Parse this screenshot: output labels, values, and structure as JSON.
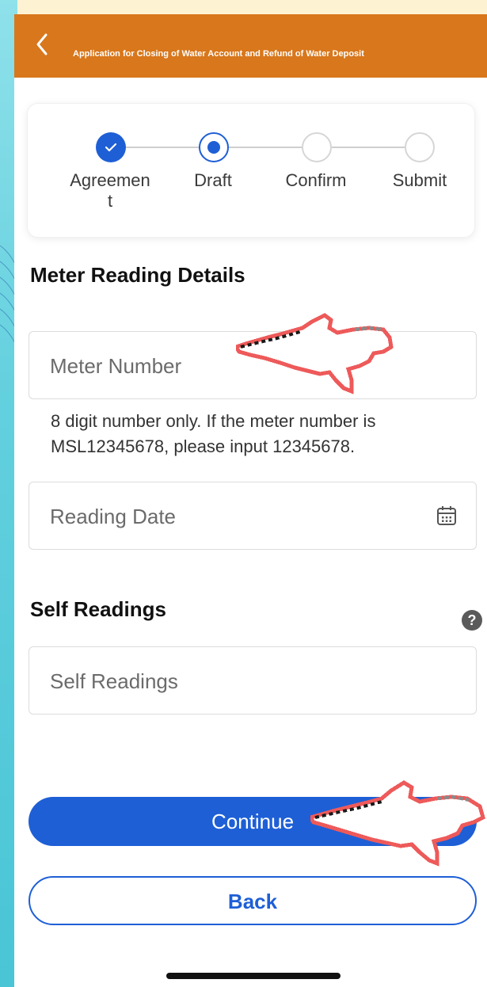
{
  "header": {
    "title": "Application for Closing of Water Account and Refund of Water Deposit",
    "color": "#d8771c"
  },
  "stepper": {
    "steps": [
      {
        "label": "Agreemen\nt",
        "state": "done"
      },
      {
        "label": "Draft",
        "state": "active"
      },
      {
        "label": "Confirm",
        "state": "idle"
      },
      {
        "label": "Submit",
        "state": "idle"
      }
    ]
  },
  "meter_section": {
    "title": "Meter Reading Details",
    "meter_number_placeholder": "Meter Number",
    "meter_hint": "8 digit number only. If the meter number is MSL12345678, please input 12345678.",
    "reading_date_placeholder": "Reading Date"
  },
  "self_section": {
    "title": "Self Readings",
    "help": "?",
    "self_readings_placeholder": "Self Readings"
  },
  "actions": {
    "continue_label": "Continue",
    "back_label": "Back"
  },
  "colors": {
    "primary": "#1e5fd6",
    "header": "#d8771c",
    "cursor_outline": "#ee5a5a"
  },
  "icons": [
    "back-chevron-icon",
    "check-icon",
    "calendar-icon",
    "help-icon",
    "pointer-hand-icon"
  ]
}
